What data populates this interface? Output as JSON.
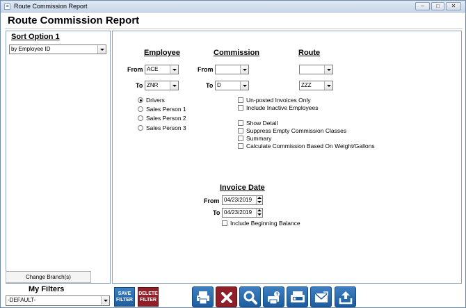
{
  "window": {
    "title": "Route Commission Report"
  },
  "app_title": "Route Commission Report",
  "sort": {
    "title": "Sort Option 1",
    "value": "by Employee ID"
  },
  "change_branch_label": "Change Branch(s)",
  "employee": {
    "title": "Employee",
    "from_label": "From",
    "from_value": "ACE",
    "to_label": "To",
    "to_value": "ZNR",
    "radios": [
      {
        "label": "Drivers",
        "checked": true
      },
      {
        "label": "Sales Person 1",
        "checked": false
      },
      {
        "label": "Sales Person 2",
        "checked": false
      },
      {
        "label": "Sales Person 3",
        "checked": false
      }
    ]
  },
  "commission": {
    "title": "Commission",
    "from_label": "From",
    "from_value": "",
    "to_label": "To",
    "to_value": "D"
  },
  "route": {
    "title": "Route",
    "from_value": "",
    "to_value": "ZZZ"
  },
  "options": [
    {
      "label": "Un-posted Invoices Only",
      "checked": false
    },
    {
      "label": "Include Inactive Employees",
      "checked": false
    },
    {
      "label": "Show Detail",
      "checked": false
    },
    {
      "label": "Suppress Empty Commission Classes",
      "checked": false
    },
    {
      "label": "Summary",
      "checked": false
    },
    {
      "label": "Calculate Commission Based On Weight/Gallons",
      "checked": false
    }
  ],
  "invoice_date": {
    "title": "Invoice Date",
    "from_label": "From",
    "from_value": "04/23/2019",
    "to_label": "To",
    "to_value": "04/23/2019",
    "include_beginning_balance": "Include Beginning Balance"
  },
  "filters": {
    "title": "My Filters",
    "value": "-DEFAULT-",
    "save_label_1": "SAVE",
    "save_label_2": "FILTER",
    "delete_label_1": "DELETE",
    "delete_label_2": "FILTER"
  },
  "toolbar_icons": [
    "print-icon",
    "close-icon",
    "search-icon",
    "print-preview-icon",
    "fax-icon",
    "email-icon",
    "export-icon"
  ],
  "colors": {
    "toolbar_blue": "#2a6db0",
    "delete_red": "#8f1f28",
    "panel_border": "#8aa0bb"
  }
}
